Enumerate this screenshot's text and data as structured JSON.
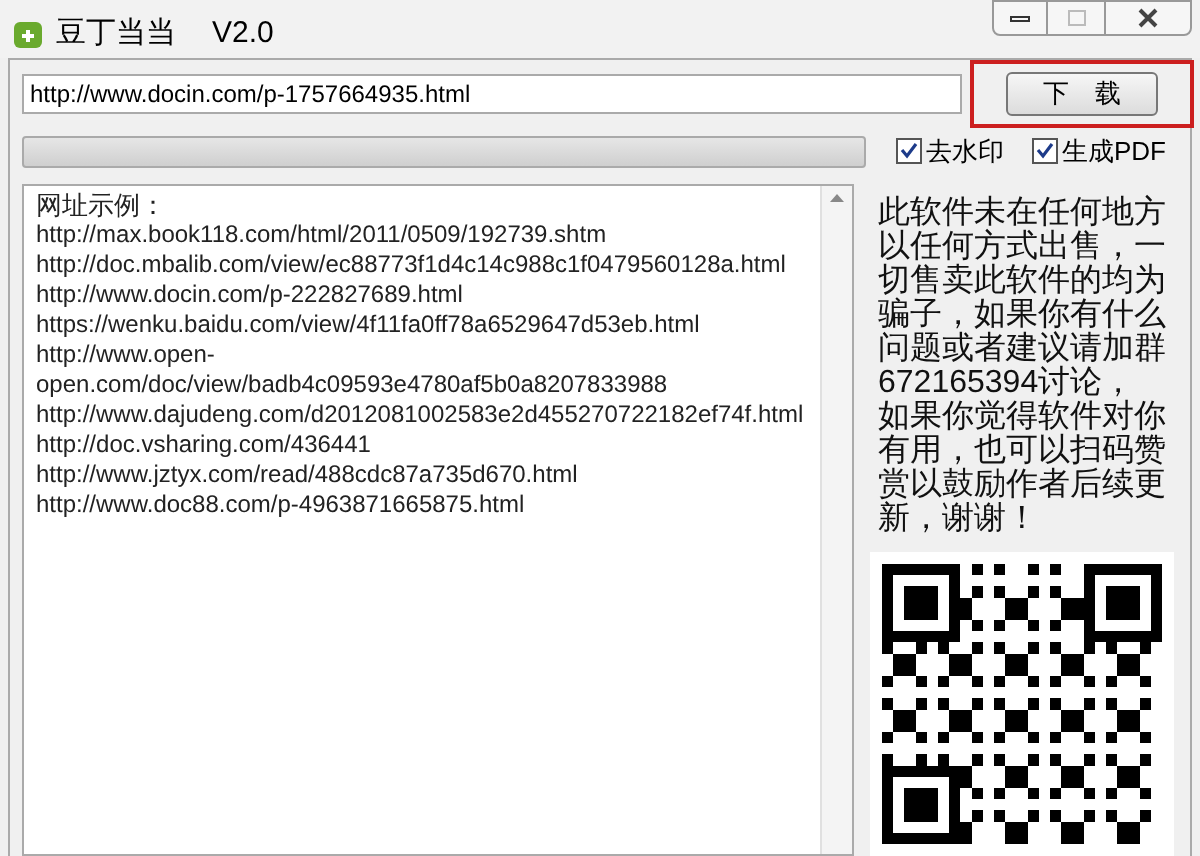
{
  "window": {
    "title": "豆丁当当",
    "version": "V2.0",
    "maximize_disabled": true
  },
  "url_field": {
    "value": "http://www.docin.com/p-1757664935.html"
  },
  "download_button": {
    "label": "下　载",
    "highlighted": true
  },
  "progress": {
    "level": 0
  },
  "options": [
    {
      "label": "去水印",
      "checked": true
    },
    {
      "label": "生成PDF",
      "checked": true
    }
  ],
  "examples": {
    "heading": "网址示例：",
    "lines": [
      "http://max.book118.com/html/2011/0509/192739.shtm",
      "http://doc.mbalib.com/view/ec88773f1d4c14c988c1f0479560128a.html",
      "http://www.docin.com/p-222827689.html",
      "https://wenku.baidu.com/view/4f11fa0ff78a6529647d53eb.html",
      "http://www.open-open.com/doc/view/badb4c09593e4780af5b0a8207833988",
      "http://www.dajudeng.com/d2012081002583e2d455270722182ef74f.html",
      "http://doc.vsharing.com/436441",
      "http://www.jztyx.com/read/488cdc87a735d670.html",
      "http://www.doc88.com/p-4963871665875.html"
    ]
  },
  "notice": "此软件未在任何地方以任何方式出售，一切售卖此软件的均为骗子，如果你有什么问题或者建议请加群672165394讨论，如果你觉得软件对你有用，也可以扫码赞赏以鼓励作者后续更新，谢谢！"
}
